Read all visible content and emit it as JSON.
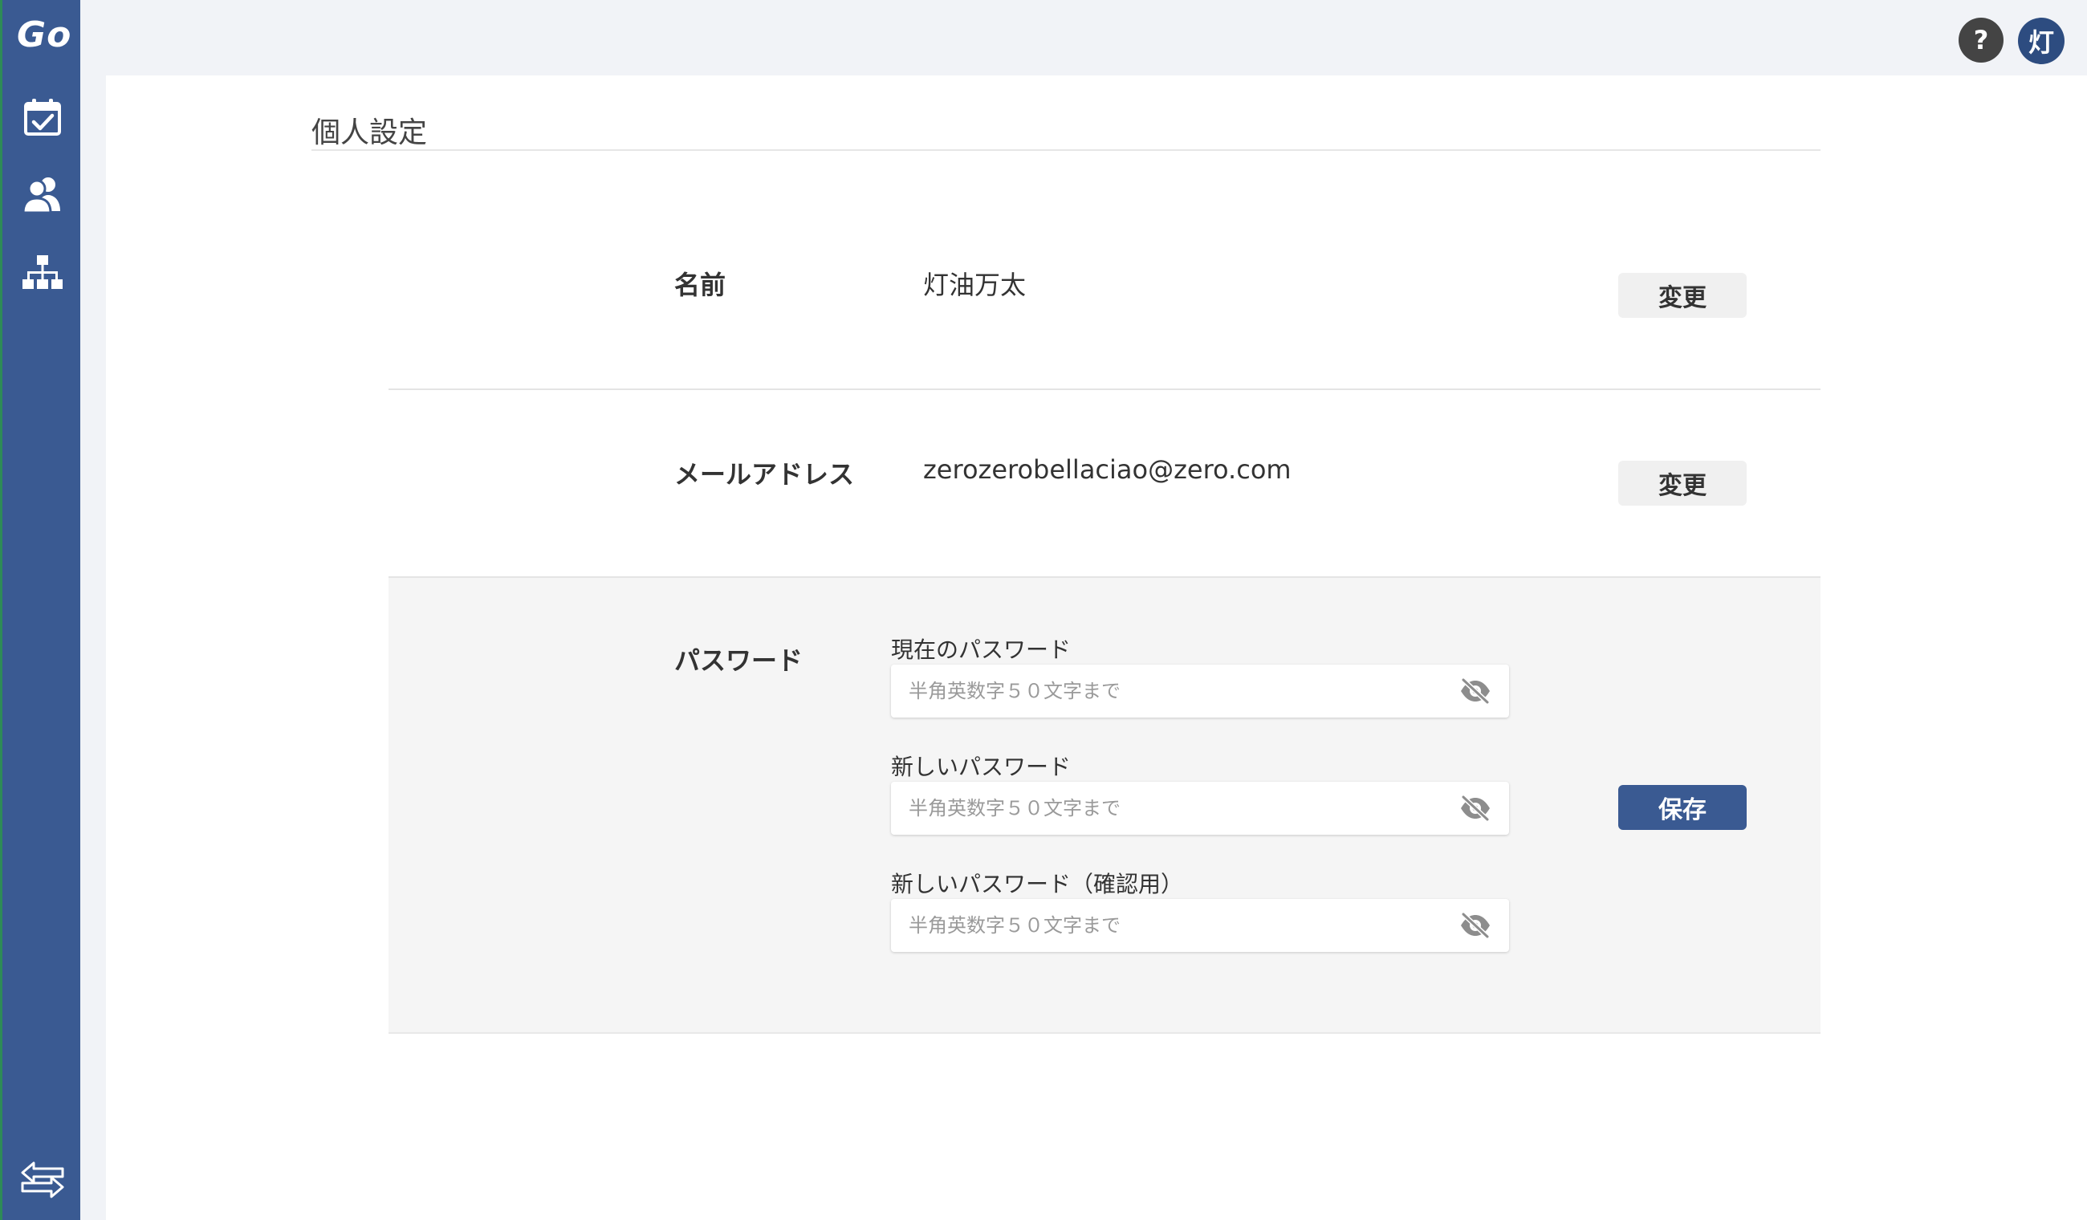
{
  "sidebar": {
    "logo": "Go",
    "items": [
      {
        "name": "calendar-check-icon"
      },
      {
        "name": "users-icon"
      },
      {
        "name": "org-chart-icon"
      }
    ],
    "bottom": {
      "name": "swap-arrows-icon"
    }
  },
  "header": {
    "help_label": "?",
    "avatar_initial": "灯"
  },
  "page": {
    "title": "個人設定"
  },
  "name_row": {
    "label": "名前",
    "value": "灯油万太",
    "button": "変更"
  },
  "email_row": {
    "label": "メールアドレス",
    "value": "zerozerobellaciao@zero.com",
    "button": "変更"
  },
  "password_row": {
    "label": "パスワード",
    "fields": [
      {
        "label": "現在のパスワード",
        "placeholder": "半角英数字５０文字まで",
        "value": ""
      },
      {
        "label": "新しいパスワード",
        "placeholder": "半角英数字５０文字まで",
        "value": ""
      },
      {
        "label": "新しいパスワード（確認用）",
        "placeholder": "半角英数字５０文字まで",
        "value": ""
      }
    ],
    "save_button": "保存"
  },
  "colors": {
    "sidebar": "#3a5a92",
    "primary_button": "#3a5a92",
    "avatar": "#2d4c80",
    "help": "#444444"
  }
}
